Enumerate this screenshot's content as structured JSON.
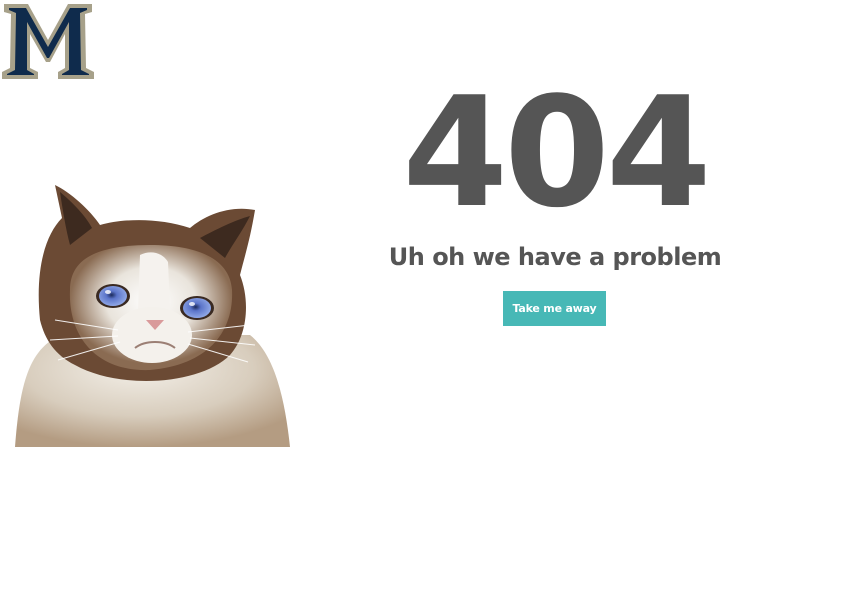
{
  "logo": {
    "letter": "M",
    "fill_color": "#0f2b4c",
    "trim_color": "#a7a18a"
  },
  "hero_image": {
    "icon": "grumpy-cat-image"
  },
  "error": {
    "code": "404",
    "message": "Uh oh we have a problem"
  },
  "actions": {
    "primary_label": "Take me away"
  },
  "colors": {
    "text": "#555555",
    "button": "#47b8b6",
    "button_text": "#ffffff",
    "background": "#ffffff"
  }
}
